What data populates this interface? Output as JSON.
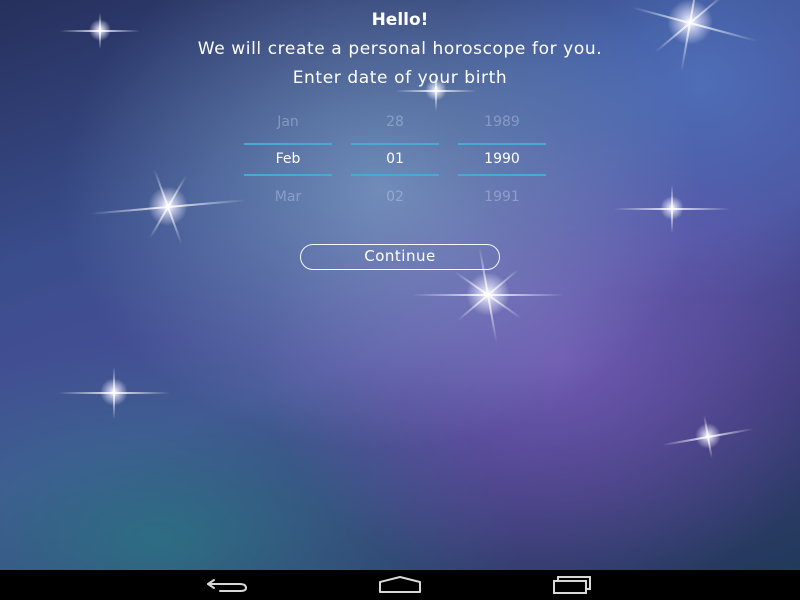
{
  "header": {
    "greeting": "Hello!",
    "subtitle": "We will create a personal horoscope for you.",
    "prompt": "Enter date of your birth"
  },
  "date_picker": {
    "month": {
      "prev": "Jan",
      "selected": "Feb",
      "next": "Mar"
    },
    "day": {
      "prev": "28",
      "selected": "01",
      "next": "02"
    },
    "year": {
      "prev": "1989",
      "selected": "1990",
      "next": "1991"
    }
  },
  "continue_label": "Continue",
  "navbar": {
    "back_icon": "back-arrow-icon",
    "home_icon": "home-icon",
    "recents_icon": "recent-apps-icon"
  },
  "colors": {
    "accent_divider": "#4aa8d8",
    "text": "#ffffff",
    "navbar": "#000000"
  }
}
